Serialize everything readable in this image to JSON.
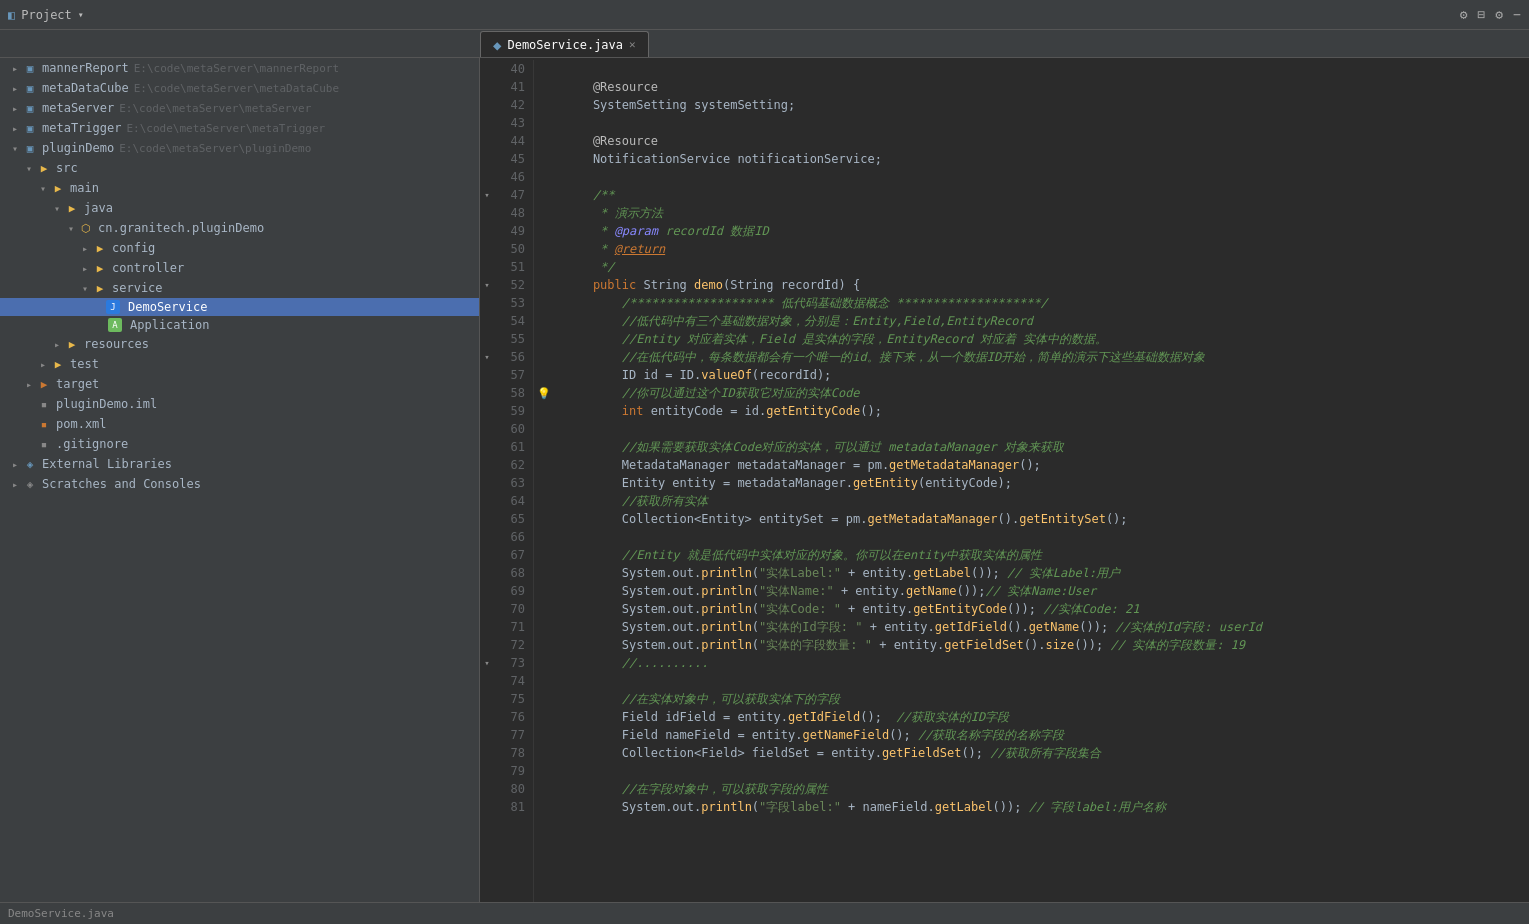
{
  "titleBar": {
    "projectLabel": "Project",
    "icons": [
      "settings-icon",
      "splitview-icon",
      "gear-icon",
      "minimize-icon"
    ]
  },
  "tab": {
    "label": "DemoService.java",
    "active": true
  },
  "sidebar": {
    "items": [
      {
        "id": "mannerReport",
        "label": "mannerReport",
        "path": "E:\\code\\metaServer\\mannerReport",
        "indent": 1,
        "type": "module",
        "arrow": "collapsed"
      },
      {
        "id": "metaDataCube",
        "label": "metaDataCube",
        "path": "E:\\code\\metaServer\\metaDataCube",
        "indent": 1,
        "type": "module",
        "arrow": "collapsed"
      },
      {
        "id": "metaServer",
        "label": "metaServer",
        "path": "E:\\code\\metaServer\\metaServer",
        "indent": 1,
        "type": "module",
        "arrow": "collapsed"
      },
      {
        "id": "metaTrigger",
        "label": "metaTrigger",
        "path": "E:\\code\\metaServer\\metaTrigger",
        "indent": 1,
        "type": "module",
        "arrow": "collapsed"
      },
      {
        "id": "pluginDemo",
        "label": "pluginDemo",
        "path": "E:\\code\\metaServer\\pluginDemo",
        "indent": 1,
        "type": "module",
        "arrow": "expanded"
      },
      {
        "id": "src",
        "label": "src",
        "indent": 2,
        "type": "folder",
        "arrow": "expanded"
      },
      {
        "id": "main",
        "label": "main",
        "indent": 3,
        "type": "folder",
        "arrow": "expanded"
      },
      {
        "id": "java",
        "label": "java",
        "indent": 4,
        "type": "folder",
        "arrow": "expanded"
      },
      {
        "id": "cn.granitech.pluginDemo",
        "label": "cn.granitech.pluginDemo",
        "indent": 5,
        "type": "package",
        "arrow": "expanded"
      },
      {
        "id": "config",
        "label": "config",
        "indent": 6,
        "type": "folder",
        "arrow": "collapsed"
      },
      {
        "id": "controller",
        "label": "controller",
        "indent": 6,
        "type": "folder",
        "arrow": "collapsed"
      },
      {
        "id": "service",
        "label": "service",
        "indent": 6,
        "type": "folder",
        "arrow": "expanded"
      },
      {
        "id": "DemoService",
        "label": "DemoService",
        "indent": 7,
        "type": "java",
        "arrow": "empty",
        "selected": true
      },
      {
        "id": "Application",
        "label": "Application",
        "indent": 7,
        "type": "app",
        "arrow": "empty"
      },
      {
        "id": "resources",
        "label": "resources",
        "indent": 4,
        "type": "folder",
        "arrow": "collapsed"
      },
      {
        "id": "test",
        "label": "test",
        "indent": 3,
        "type": "folder",
        "arrow": "collapsed"
      },
      {
        "id": "target",
        "label": "target",
        "indent": 2,
        "type": "folder-orange",
        "arrow": "collapsed"
      },
      {
        "id": "pluginDemo.iml",
        "label": "pluginDemo.iml",
        "indent": 2,
        "type": "iml",
        "arrow": "empty"
      },
      {
        "id": "pom.xml",
        "label": "pom.xml",
        "indent": 2,
        "type": "xml",
        "arrow": "empty"
      },
      {
        "id": ".gitignore",
        "label": ".gitignore",
        "indent": 2,
        "type": "gitignore",
        "arrow": "empty"
      },
      {
        "id": "ExternalLibraries",
        "label": "External Libraries",
        "indent": 1,
        "type": "folder",
        "arrow": "collapsed"
      },
      {
        "id": "ScratchesAndConsoles",
        "label": "Scratches and Consoles",
        "indent": 1,
        "type": "folder",
        "arrow": "collapsed"
      }
    ]
  },
  "editor": {
    "filename": "DemoService.java",
    "lines": [
      {
        "num": 40,
        "content": "",
        "tokens": []
      },
      {
        "num": 41,
        "content": "    @Resource",
        "tokens": [
          {
            "t": "annotation",
            "v": "    @Resource"
          }
        ]
      },
      {
        "num": 42,
        "content": "    SystemSetting systemSetting;",
        "tokens": [
          {
            "t": "type",
            "v": "    SystemSetting systemSetting;"
          }
        ]
      },
      {
        "num": 43,
        "content": "",
        "tokens": []
      },
      {
        "num": 44,
        "content": "    @Resource",
        "tokens": [
          {
            "t": "annotation",
            "v": "    @Resource"
          }
        ]
      },
      {
        "num": 45,
        "content": "    NotificationService notificationService;",
        "tokens": [
          {
            "t": "type",
            "v": "    NotificationService notificationService;"
          }
        ]
      },
      {
        "num": 46,
        "content": "",
        "tokens": []
      },
      {
        "num": 47,
        "content": "    /**",
        "fold": true,
        "tokens": [
          {
            "t": "comment",
            "v": "    /**"
          }
        ]
      },
      {
        "num": 48,
        "content": "     * 演示方法",
        "tokens": [
          {
            "t": "comment",
            "v": "     * 演示方法"
          }
        ]
      },
      {
        "num": 49,
        "content": "     * @param recordId 数据ID",
        "tokens": [
          {
            "t": "comment",
            "v": "     * @param recordId 数据ID"
          }
        ]
      },
      {
        "num": 50,
        "content": "     * @return",
        "tokens": [
          {
            "t": "comment-return",
            "v": "     * @return"
          }
        ]
      },
      {
        "num": 51,
        "content": "     */",
        "tokens": [
          {
            "t": "comment",
            "v": "     */"
          }
        ]
      },
      {
        "num": 52,
        "content": "    public String demo(String recordId) {",
        "fold": true,
        "tokens": [
          {
            "t": "code",
            "v": "    public String demo(String recordId) {"
          }
        ]
      },
      {
        "num": 53,
        "content": "        /******************** 低代码基础数据概念 ********************/",
        "tokens": [
          {
            "t": "comment-stars",
            "v": "        /******************** 低代码基础数据概念 ********************/"
          }
        ]
      },
      {
        "num": 54,
        "content": "        //低代码中有三个基础数据对象，分别是：Entity,Field,EntityRecord",
        "tokens": [
          {
            "t": "comment",
            "v": "        //低代码中有三个基础数据对象，分别是：Entity,Field,EntityRecord"
          }
        ]
      },
      {
        "num": 55,
        "content": "        //Entity 对应着实体，Field 是实体的字段，EntityRecord 对应着 实体中的数据。",
        "tokens": [
          {
            "t": "comment",
            "v": "        //Entity 对应着实体，Field 是实体的字段，EntityRecord 对应着 实体中的数据。"
          }
        ]
      },
      {
        "num": 56,
        "content": "        //在低代码中，每条数据都会有一个唯一的id。接下来，从一个数据ID开始，简单的演示下这些基础数据对象",
        "fold": true,
        "tokens": [
          {
            "t": "comment",
            "v": "        //在低代码中，每条数据都会有一个唯一的id。接下来，从一个数据ID开始，简单的演示下这些基础数据对象"
          }
        ]
      },
      {
        "num": 57,
        "content": "        ID id = ID.valueOf(recordId);",
        "tokens": [
          {
            "t": "code",
            "v": "        ID id = ID.valueOf(recordId);"
          }
        ]
      },
      {
        "num": 58,
        "content": "        //你可以通过这个ID获取它对应的实体Code",
        "bulb": true,
        "tokens": [
          {
            "t": "comment",
            "v": "        //你可以通过这个ID获取它对应的实体Code"
          }
        ]
      },
      {
        "num": 59,
        "content": "        int entityCode = id.getEntityCode();",
        "tokens": [
          {
            "t": "code",
            "v": "        int entityCode = id.getEntityCode();"
          }
        ]
      },
      {
        "num": 60,
        "content": "",
        "tokens": []
      },
      {
        "num": 61,
        "content": "        //如果需要获取实体Code对应的实体，可以通过 metadataManager 对象来获取",
        "tokens": [
          {
            "t": "comment",
            "v": "        //如果需要获取实体Code对应的实体，可以通过 metadataManager 对象来获取"
          }
        ]
      },
      {
        "num": 62,
        "content": "        MetadataManager metadataManager = pm.getMetadataManager();",
        "tokens": [
          {
            "t": "code",
            "v": "        MetadataManager metadataManager = pm.getMetadataManager();"
          }
        ]
      },
      {
        "num": 63,
        "content": "        Entity entity = metadataManager.getEntity(entityCode);",
        "tokens": [
          {
            "t": "code",
            "v": "        Entity entity = metadataManager.getEntity(entityCode);"
          }
        ]
      },
      {
        "num": 64,
        "content": "        //获取所有实体",
        "tokens": [
          {
            "t": "comment",
            "v": "        //获取所有实体"
          }
        ]
      },
      {
        "num": 65,
        "content": "        Collection<Entity> entitySet = pm.getMetadataManager().getEntitySet();",
        "tokens": [
          {
            "t": "code",
            "v": "        Collection<Entity> entitySet = pm.getMetadataManager().getEntitySet();"
          }
        ]
      },
      {
        "num": 66,
        "content": "",
        "tokens": []
      },
      {
        "num": 67,
        "content": "        //Entity 就是低代码中实体对应的对象。你可以在entity中获取实体的属性",
        "tokens": [
          {
            "t": "comment",
            "v": "        //Entity 就是低代码中实体对应的对象。你可以在entity中获取实体的属性"
          }
        ]
      },
      {
        "num": 68,
        "content": "        System.out.println(\"实体Label:\" + entity.getLabel()); // 实体Label:用户",
        "tokens": [
          {
            "t": "code",
            "v": "        System.out.println(\"实体Label:\" + entity.getLabel()); // 实体Label:用户"
          }
        ]
      },
      {
        "num": 69,
        "content": "        System.out.println(\"实体Name:\" + entity.getName());// 实体Name:User",
        "tokens": [
          {
            "t": "code",
            "v": "        System.out.println(\"实体Name:\" + entity.getName());// 实体Name:User"
          }
        ]
      },
      {
        "num": 70,
        "content": "        System.out.println(\"实体Code: \" + entity.getEntityCode()); //实体Code: 21",
        "tokens": [
          {
            "t": "code",
            "v": "        System.out.println(\"实体Code: \" + entity.getEntityCode()); //实体Code: 21"
          }
        ]
      },
      {
        "num": 71,
        "content": "        System.out.println(\"实体的Id字段: \" + entity.getIdField().getName()); //实体的Id字段: userId",
        "tokens": [
          {
            "t": "code",
            "v": "        System.out.println(\"实体的Id字段: \" + entity.getIdField().getName()); //实体的Id字段: userId"
          }
        ]
      },
      {
        "num": 72,
        "content": "        System.out.println(\"实体的字段数量: \" + entity.getFieldSet().size()); // 实体的字段数量: 19",
        "tokens": [
          {
            "t": "code",
            "v": "        System.out.println(\"实体的字段数量: \" + entity.getFieldSet().size()); // 实体的字段数量: 19"
          }
        ]
      },
      {
        "num": 73,
        "content": "        //..........",
        "fold": true,
        "tokens": [
          {
            "t": "comment",
            "v": "        //.........."
          }
        ]
      },
      {
        "num": 74,
        "content": "",
        "tokens": []
      },
      {
        "num": 75,
        "content": "        //在实体对象中，可以获取实体下的字段",
        "tokens": [
          {
            "t": "comment",
            "v": "        //在实体对象中，可以获取实体下的字段"
          }
        ]
      },
      {
        "num": 76,
        "content": "        Field idField = entity.getIdField();  //获取实体的ID字段",
        "tokens": [
          {
            "t": "code",
            "v": "        Field idField = entity.getIdField();  //获取实体的ID字段"
          }
        ]
      },
      {
        "num": 77,
        "content": "        Field nameField = entity.getNameField(); //获取名称字段的名称字段",
        "tokens": [
          {
            "t": "code",
            "v": "        Field nameField = entity.getNameField(); //获取名称字段的名称字段"
          }
        ]
      },
      {
        "num": 78,
        "content": "        Collection<Field> fieldSet = entity.getFieldSet(); //获取所有字段集合",
        "tokens": [
          {
            "t": "code",
            "v": "        Collection<Field> fieldSet = entity.getFieldSet(); //获取所有字段集合"
          }
        ]
      },
      {
        "num": 79,
        "content": "",
        "tokens": []
      },
      {
        "num": 80,
        "content": "        //在字段对象中，可以获取字段的属性",
        "tokens": [
          {
            "t": "comment",
            "v": "        //在字段对象中，可以获取字段的属性"
          }
        ]
      },
      {
        "num": 81,
        "content": "        System.out.println(\"字段label:\" + nameField.getLabel()); // 字段label:用户名称",
        "tokens": [
          {
            "t": "code",
            "v": "        System.out.println(\"字段label:\" + nameField.getLabel()); // 字段label:用户名称"
          }
        ]
      }
    ]
  }
}
